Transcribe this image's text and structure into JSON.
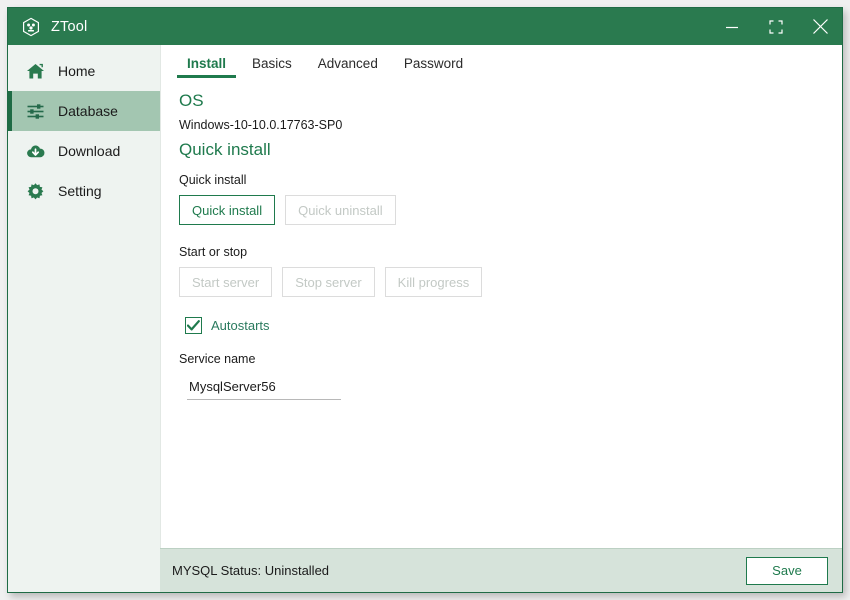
{
  "window": {
    "title": "ZTool",
    "logo_icon": "hexagon-mascot-icon",
    "controls": [
      {
        "name": "minimize",
        "icon": "minimize-icon"
      },
      {
        "name": "maximize",
        "icon": "maximize-icon"
      },
      {
        "name": "close",
        "icon": "close-icon"
      }
    ]
  },
  "colors": {
    "titlebar_green": "#2a7a4f",
    "accent_green": "#1f7a4d",
    "sidebar_bg": "#eef3f0",
    "sidebar_selected_bg": "#a3c6b1",
    "statusbar_bg": "#d6e3da",
    "disabled_gray": "#c3c9c5"
  },
  "sidebar": {
    "items": [
      {
        "label": "Home",
        "icon": "home-icon",
        "selected": false
      },
      {
        "label": "Database",
        "icon": "sliders-icon",
        "selected": true
      },
      {
        "label": "Download",
        "icon": "cloud-download-icon",
        "selected": false
      },
      {
        "label": "Setting",
        "icon": "gear-icon",
        "selected": false
      }
    ]
  },
  "main": {
    "tabs": [
      {
        "label": "Install",
        "active": true
      },
      {
        "label": "Basics",
        "active": false
      },
      {
        "label": "Advanced",
        "active": false
      },
      {
        "label": "Password",
        "active": false
      }
    ],
    "os_section": {
      "heading": "OS",
      "value": "Windows-10-10.0.17763-SP0"
    },
    "quick_install_heading": "Quick install",
    "quick_install_group": {
      "label": "Quick install",
      "buttons": [
        {
          "label": "Quick install",
          "enabled": true
        },
        {
          "label": "Quick uninstall",
          "enabled": false
        }
      ]
    },
    "start_stop_group": {
      "label": "Start or stop",
      "buttons": [
        {
          "label": "Start server",
          "enabled": false
        },
        {
          "label": "Stop server",
          "enabled": false
        },
        {
          "label": "Kill progress",
          "enabled": false
        }
      ]
    },
    "autostarts": {
      "label": "Autostarts",
      "checked": true,
      "icon": "checkmark-icon"
    },
    "service_name": {
      "label": "Service name",
      "value": "MysqlServer56",
      "placeholder": "Service name"
    }
  },
  "status_bar": {
    "status_text": "MYSQL Status: Uninstalled",
    "save_label": "Save"
  }
}
